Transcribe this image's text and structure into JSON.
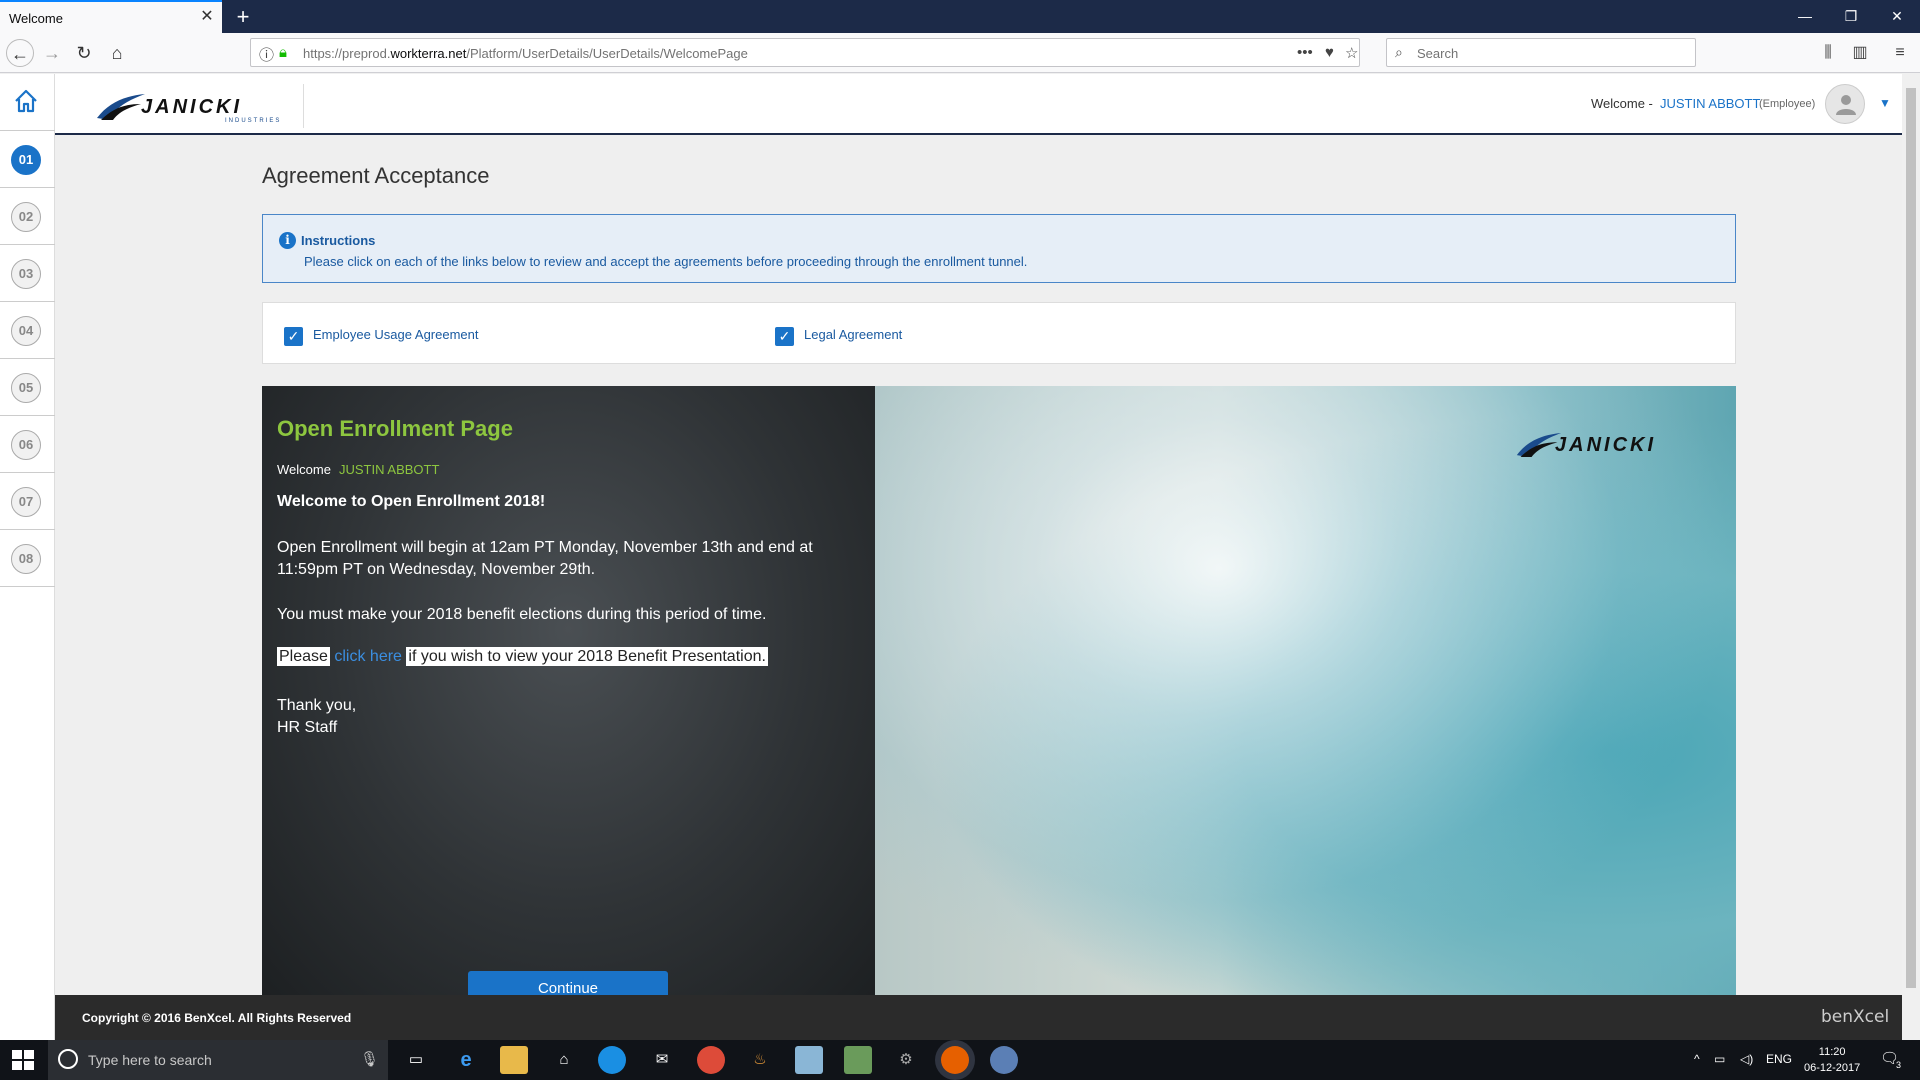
{
  "browser": {
    "tab_title": "Welcome",
    "url_prefix": "https://preprod.",
    "url_domain": "workterra.net",
    "url_path": "/Platform/UserDetails/UserDetails/WelcomePage",
    "search_placeholder": "Search"
  },
  "header": {
    "logo": "JANICKI",
    "logo_sub": "INDUSTRIES",
    "welcome_label": "Welcome -",
    "user_name": "JUSTIN ABBOTT",
    "user_role": "(Employee)"
  },
  "steps": [
    "01",
    "02",
    "03",
    "04",
    "05",
    "06",
    "07",
    "08"
  ],
  "page": {
    "title": "Agreement Acceptance",
    "instructions_title": "Instructions",
    "instructions_text": "Please click on each of the links below to review and accept the agreements before proceeding through the enrollment tunnel.",
    "agreements": [
      "Employee Usage Agreement",
      "Legal Agreement"
    ]
  },
  "banner": {
    "title": "Open Enrollment Page",
    "welcome": "Welcome",
    "name": "JUSTIN ABBOTT",
    "heading": "Welcome to Open Enrollment 2018!",
    "para1": "Open Enrollment will begin at 12am PT Monday, November 13th and end at 11:59pm PT on Wednesday, November 29th.",
    "para2": "You must make your 2018 benefit elections during this period of time.",
    "para3_pre": "Please",
    "para3_link": "click here",
    "para3_post": "if you wish to view your 2018 Benefit Presentation.",
    "thanks": "Thank you,",
    "signoff": "HR Staff",
    "continue": "Continue"
  },
  "footer": {
    "copyright": "Copyright © 2016 BenXcel. All Rights Reserved",
    "brand": "benXcel"
  },
  "taskbar": {
    "search_placeholder": "Type here to search",
    "lang": "ENG",
    "time": "11:20",
    "date": "06-12-2017",
    "notif_count": "3"
  }
}
